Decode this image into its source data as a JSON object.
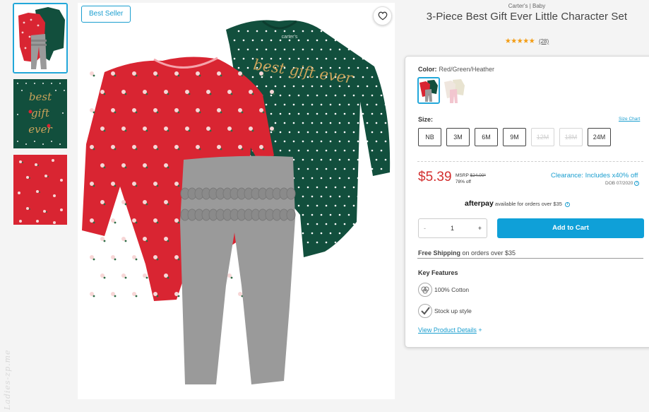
{
  "gallery": {
    "badge": "Best Seller",
    "thumbnails": [
      "set-thumbnail",
      "green-bodysuit-detail",
      "red-bodysuit-detail"
    ],
    "graphic_text": "best gift ever",
    "bodysuit_label": "carter's"
  },
  "watermark": "Ladies-zp.me",
  "product": {
    "brand": "Carter's | Baby",
    "title": "3-Piece Best Gift Ever Little Character Set",
    "stars": "★★★★★",
    "rating_value": 5,
    "review_count": "(28)"
  },
  "options": {
    "color_label": "Color:",
    "color_value": "Red/Green/Heather",
    "size_label": "Size:",
    "size_chart_link": "Size Chart",
    "sizes": [
      {
        "label": "NB",
        "available": true
      },
      {
        "label": "3M",
        "available": true
      },
      {
        "label": "6M",
        "available": true
      },
      {
        "label": "9M",
        "available": true
      },
      {
        "label": "12M",
        "available": false
      },
      {
        "label": "18M",
        "available": false
      },
      {
        "label": "24M",
        "available": true
      }
    ]
  },
  "pricing": {
    "price": "$5.39",
    "msrp_label": "MSRP",
    "msrp_value": "$24.00*",
    "discount": "78% off",
    "clearance": "Clearance: Includes x40% off",
    "dob": "DOB 07/2020",
    "info_icon": "i"
  },
  "afterpay": {
    "logo": "afterpay",
    "text": "available for orders over $35"
  },
  "cart": {
    "minus": "-",
    "quantity": "1",
    "plus": "+",
    "add_label": "Add to Cart"
  },
  "shipping": {
    "bold": "Free Shipping",
    "text": " on orders over $35"
  },
  "features": {
    "title": "Key Features",
    "items": [
      {
        "icon": "cotton-icon",
        "label": "100% Cotton"
      },
      {
        "icon": "check-icon",
        "label": "Stock up style"
      }
    ],
    "view_details": "View Product Details",
    "view_details_icon": "+"
  },
  "colors": {
    "accent": "#1a9ecf",
    "price": "#d32f2f",
    "cart_button": "#0fa0d8",
    "red_fabric": "#d92532",
    "green_fabric": "#124f3d",
    "heather_gray": "#9a9a9a",
    "gold_text": "#c9a25a"
  }
}
